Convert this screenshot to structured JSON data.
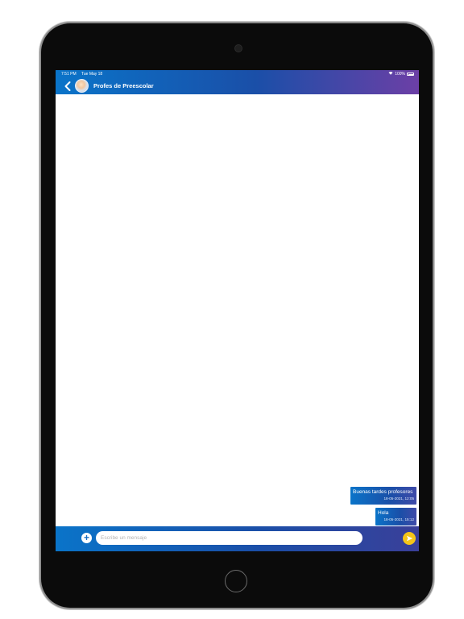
{
  "status_bar": {
    "time": "7:51 PM",
    "date": "Tue May 18",
    "battery": "100%"
  },
  "header": {
    "title": "Profes de Preescolar"
  },
  "messages": [
    {
      "text": "Buenas tardes profesores",
      "timestamp": "18-05-2021, 12:05"
    },
    {
      "text": "Hola",
      "timestamp": "18-05-2021, 15:12"
    }
  ],
  "composer": {
    "placeholder": "Escribe un mensaje",
    "add_symbol": "+"
  },
  "colors": {
    "gradient_start": "#0a74c9",
    "gradient_end": "#6c3fa6",
    "send_button": "#f5c518"
  }
}
